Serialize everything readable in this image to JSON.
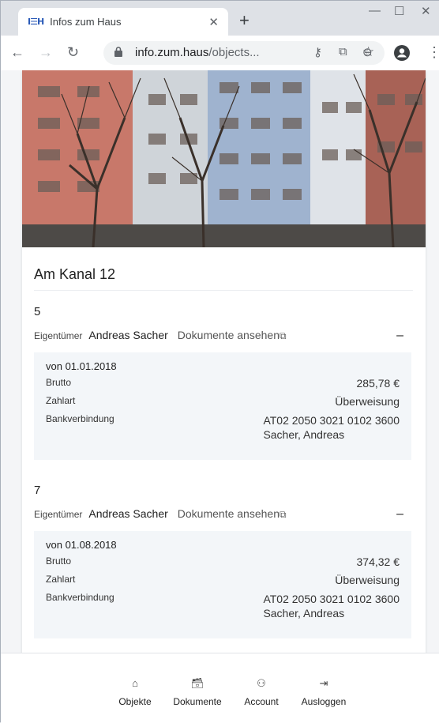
{
  "browser": {
    "tab_title": "Infos zum Haus",
    "favicon_text": "I☰H",
    "url_host": "info.zum.haus",
    "url_path": "/objects..."
  },
  "property": {
    "address": "Am Kanal 12"
  },
  "units": [
    {
      "number": "5",
      "owner_label": "Eigentümer",
      "owner_name": "Andreas Sacher",
      "documents_link": "Dokumente ansehen",
      "collapse_symbol": "–",
      "from": "von 01.01.2018",
      "gross_label": "Brutto",
      "gross_value": "285,78 €",
      "payment_label": "Zahlart",
      "payment_value": "Überweisung",
      "bank_label": "Bankverbindung",
      "iban": "AT02 2050 3021 0102 3600",
      "account_holder": "Sacher, Andreas"
    },
    {
      "number": "7",
      "owner_label": "Eigentümer",
      "owner_name": "Andreas Sacher",
      "documents_link": "Dokumente ansehen",
      "collapse_symbol": "–",
      "from": "von 01.08.2018",
      "gross_label": "Brutto",
      "gross_value": "374,32 €",
      "payment_label": "Zahlart",
      "payment_value": "Überweisung",
      "bank_label": "Bankverbindung",
      "iban": "AT02 2050 3021 0102 3600",
      "account_holder": "Sacher, Andreas"
    }
  ],
  "bottom_nav": {
    "objects": "Objekte",
    "documents": "Dokumente",
    "account": "Account",
    "logout": "Ausloggen"
  },
  "icons": [
    "home-icon",
    "archive-icon",
    "user-icon",
    "logout-icon",
    "external-link-icon"
  ]
}
